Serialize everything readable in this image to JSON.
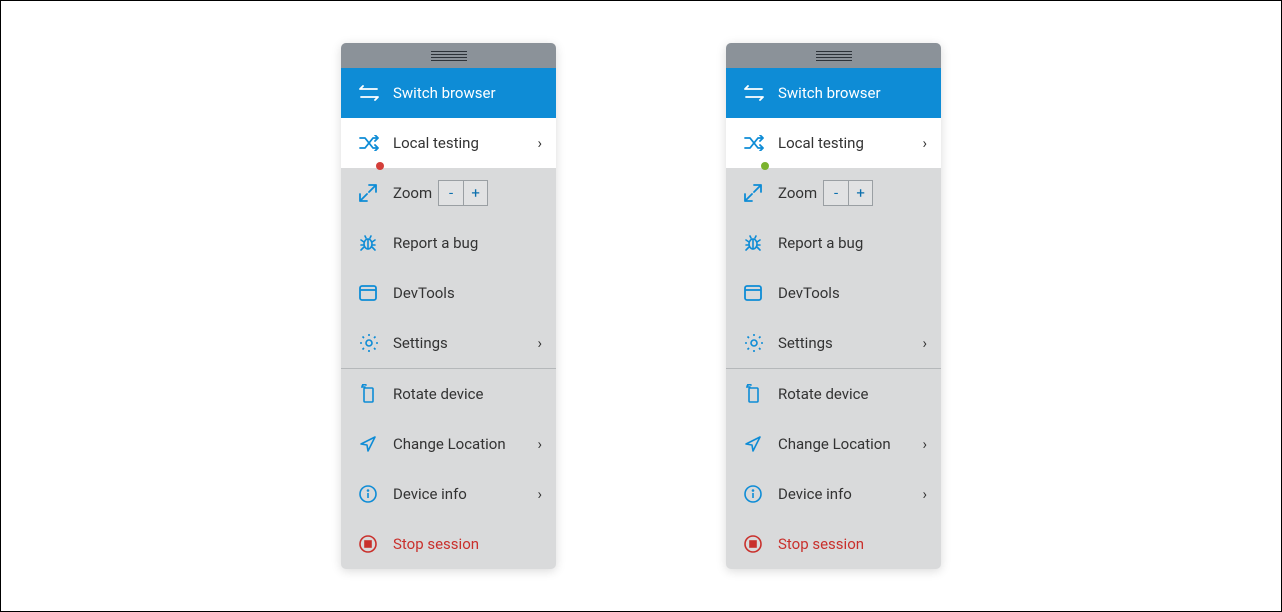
{
  "panels": [
    {
      "local_dot_color": "#d43f3a",
      "items": {
        "switch": "Switch browser",
        "local": "Local testing",
        "zoom": "Zoom",
        "zoom_minus": "-",
        "zoom_plus": "+",
        "report": "Report a bug",
        "devtools": "DevTools",
        "settings": "Settings",
        "rotate": "Rotate device",
        "location": "Change Location",
        "info": "Device info",
        "stop": "Stop session"
      }
    },
    {
      "local_dot_color": "#7bb32e",
      "items": {
        "switch": "Switch browser",
        "local": "Local testing",
        "zoom": "Zoom",
        "zoom_minus": "-",
        "zoom_plus": "+",
        "report": "Report a bug",
        "devtools": "DevTools",
        "settings": "Settings",
        "rotate": "Rotate device",
        "location": "Change Location",
        "info": "Device info",
        "stop": "Stop session"
      }
    }
  ]
}
